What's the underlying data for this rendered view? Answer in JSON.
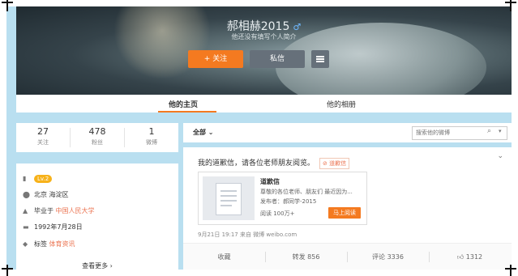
{
  "profile": {
    "nickname": "郝相赫2015",
    "gender_symbol": "♂",
    "intro": "他还没有填写个人简介",
    "follow_label": "关注",
    "follow_icon": "+",
    "message_label": "私信"
  },
  "tabs": [
    {
      "label": "他的主页",
      "active": true
    },
    {
      "label": "他的相册",
      "active": false
    }
  ],
  "stats": [
    {
      "value": "27",
      "label": "关注"
    },
    {
      "value": "478",
      "label": "粉丝"
    },
    {
      "value": "1",
      "label": "微博"
    }
  ],
  "info": {
    "level": "Lv.2",
    "location": "北京 海淀区",
    "school_prefix": "毕业于",
    "school": "中国人民大学",
    "birthday": "1992年7月28日",
    "tags_prefix": "标签",
    "tags": "体育资讯",
    "see_more": "查看更多",
    "see_more_arrow": "›"
  },
  "feed": {
    "filter_label": "全部",
    "search_placeholder": "搜索他的微博"
  },
  "post": {
    "text": "我的道歉信，请各位老师朋友阅览。",
    "tag_label": "道歉信",
    "card": {
      "title": "道歉信",
      "desc": "尊敬的各位老师、朋友们 最近因为...",
      "author": "发布者：郝同学-2015",
      "reads": "阅读 100万+",
      "button": "马上阅读"
    },
    "meta": "9月21日 19:17 来自 微博 weibo.com",
    "actions": [
      {
        "label": "收藏"
      },
      {
        "label": "转发 856"
      },
      {
        "label": "评论 3336"
      },
      {
        "label": "1312"
      }
    ]
  },
  "colors": {
    "accent": "#f47a20",
    "page_bg": "#b9dff0",
    "link_orange": "#eb7350",
    "level_badge": "#f7b21a"
  }
}
